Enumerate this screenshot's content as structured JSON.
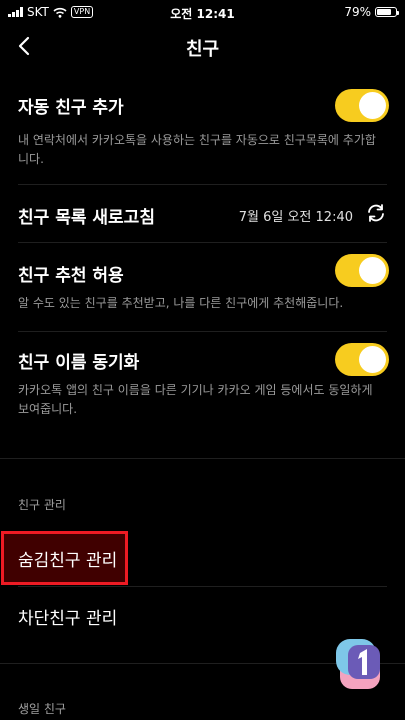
{
  "status_bar": {
    "carrier": "SKT",
    "vpn": "VPN",
    "time": "오전 12:41",
    "battery": "79%",
    "battery_level": 0.79
  },
  "header": {
    "title": "친구"
  },
  "settings": {
    "auto_add": {
      "title": "자동 친구 추가",
      "desc": "내 연락처에서 카카오톡을 사용하는 친구를 자동으로 친구목록에 추가합니다.",
      "enabled": true
    },
    "refresh": {
      "title": "친구 목록 새로고침",
      "timestamp": "7월 6일 오전 12:40"
    },
    "recommend": {
      "title": "친구 추천 허용",
      "desc": "알 수도 있는 친구를 추천받고, 나를 다른 친구에게 추천해줍니다.",
      "enabled": true
    },
    "name_sync": {
      "title": "친구 이름 동기화",
      "desc": "카카오톡 앱의 친구 이름을 다른 기기나 카카오 게임 등에서도 동일하게 보여줍니다.",
      "enabled": true
    }
  },
  "friend_manage": {
    "section_label": "친구 관리",
    "hidden_friends": "숨김친구 관리",
    "blocked_friends": "차단친구 관리"
  },
  "birthday_section_label": "생일 친구",
  "colors": {
    "toggle_on": "#f7cc1f",
    "highlight_border": "#ee1b24"
  }
}
